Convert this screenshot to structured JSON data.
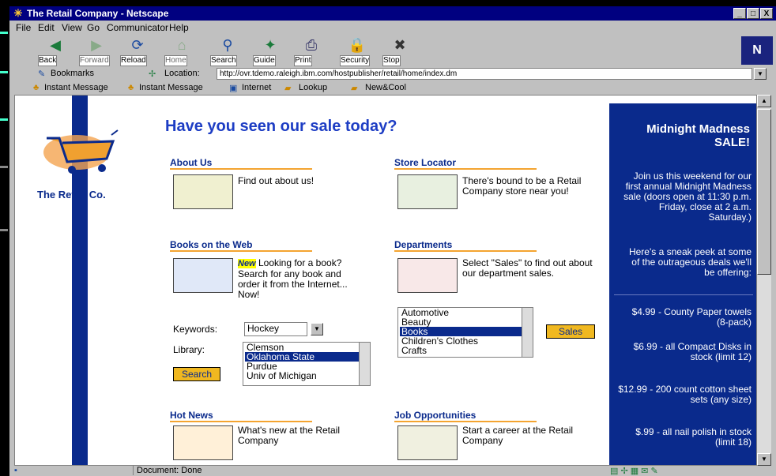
{
  "window": {
    "title": "The Retail Company - Netscape",
    "min": "_",
    "max": "□",
    "close": "X"
  },
  "menu": [
    "File",
    "Edit",
    "View",
    "Go",
    "Communicator",
    "Help"
  ],
  "toolbar": [
    {
      "label": "Back",
      "icon": "back-icon",
      "glyph": "◀"
    },
    {
      "label": "Forward",
      "icon": "forward-icon",
      "glyph": "▶"
    },
    {
      "label": "Reload",
      "icon": "reload-icon",
      "glyph": "⟳"
    },
    {
      "label": "Home",
      "icon": "home-icon",
      "glyph": "⌂"
    },
    {
      "label": "Search",
      "icon": "search-icon",
      "glyph": "⚲"
    },
    {
      "label": "Guide",
      "icon": "guide-icon",
      "glyph": "✦"
    },
    {
      "label": "Print",
      "icon": "print-icon",
      "glyph": "⎙"
    },
    {
      "label": "Security",
      "icon": "security-icon",
      "glyph": "🔒"
    },
    {
      "label": "Stop",
      "icon": "stop-icon",
      "glyph": "✖"
    }
  ],
  "logo_text": "N",
  "location": {
    "bookmarks": "Bookmarks",
    "label": "Location:",
    "url": "http://ovr.tdemo.raleigh.ibm.com/hostpublisher/retail/home/index.dm"
  },
  "personal": [
    "Instant Message",
    "Instant Message",
    "Internet",
    "Lookup",
    "New&Cool"
  ],
  "status": "Document: Done",
  "page": {
    "brand": "The Retail Co.",
    "headline": "Have you seen our sale today?",
    "about": {
      "title": "About Us",
      "text": "Find out about us!"
    },
    "store": {
      "title": "Store Locator",
      "text": "There's bound to be a Retail Company store near you!"
    },
    "books": {
      "title": "Books on the Web",
      "new": "New",
      "text": "Looking for a book? Search for any book and order it from the Internet... Now!"
    },
    "departments": {
      "title": "Departments",
      "text": "Select \"Sales\" to find out about our department sales."
    },
    "keyword_label": "Keywords:",
    "keyword_value": "Hockey",
    "library_label": "Library:",
    "library_options": [
      "Clemson",
      "Oklahoma State",
      "Purdue",
      "Univ of Michigan"
    ],
    "library_selected": 1,
    "search_button": "Search",
    "dept_options": [
      "Automotive",
      "Beauty",
      "Books",
      "Children's Clothes",
      "Crafts"
    ],
    "dept_selected": 2,
    "sales_button": "Sales",
    "hotnews": {
      "title": "Hot News",
      "text": "What's new at the Retail Company"
    },
    "jobs": {
      "title": "Job Opportunities",
      "text": "Start a career at the Retail Company"
    },
    "promo": {
      "heading": "Midnight Madness SALE!",
      "intro": "Join us this weekend for our first annual Midnight Madness sale (doors open at 11:30 p.m. Friday, close at 2 a.m. Saturday.)",
      "peek": "Here's a sneak peek at some of the outrageous deals we'll be offering:",
      "deals": [
        "$4.99 - County Paper towels (8-pack)",
        "$6.99 - all Compact Disks in stock (limit 12)",
        "$12.99 - 200 count cotton sheet sets (any size)",
        "$.99 - all nail polish in stock (limit 18)"
      ]
    }
  }
}
